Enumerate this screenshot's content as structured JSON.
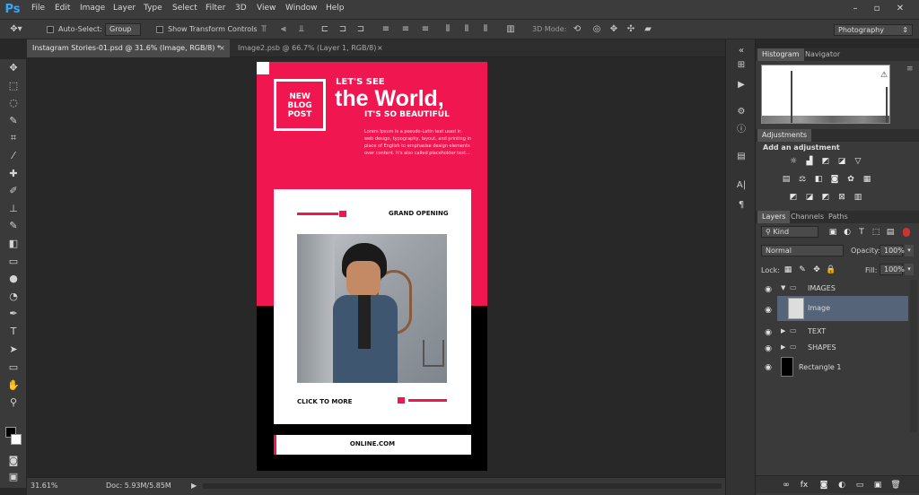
{
  "app": {
    "logo": "Ps"
  },
  "menu": [
    "File",
    "Edit",
    "Image",
    "Layer",
    "Type",
    "Select",
    "Filter",
    "3D",
    "View",
    "Window",
    "Help"
  ],
  "window_controls": {
    "minimize": "–",
    "maximize": "▫",
    "close": "✕"
  },
  "options": {
    "auto_select_label": "Auto-Select:",
    "auto_select_value": "Group",
    "show_transform_label": "Show Transform Controls",
    "mode_3d_label": "3D Mode:",
    "workspace": "Photography"
  },
  "tabs": [
    {
      "label": "Instagram Stories-01.psd @ 31.6% (Image, RGB/8) *",
      "close": "×"
    },
    {
      "label": "Image2.psb @ 66.7% (Layer 1, RGB/8)",
      "close": "×"
    }
  ],
  "status": {
    "zoom": "31.61%",
    "doc": "Doc: 5.93M/5.85M",
    "arrow": "▶"
  },
  "design": {
    "badge_line1": "NEW",
    "badge_line2": "BLOG",
    "badge_line3": "POST",
    "lets_see": "LET'S SEE",
    "headline": "the World,",
    "subhead": "IT'S SO BEAUTIFUL",
    "body": "Lorem Ipsum is a pseudo-Latin text used in web design, typography, layout, and printing in place of English to emphasise design elements over content. It's also called placeholder text...",
    "grand_opening": "GRAND OPENING",
    "click_to_more": "CLICK TO MORE",
    "online": "ONLINE.COM",
    "accent": "#f0164f"
  },
  "panels": {
    "top_tabs": [
      "Histogram",
      "Navigator"
    ],
    "adjustments_tab": "Adjustments",
    "add_adjustment": "Add an adjustment",
    "layer_tabs": [
      "Layers",
      "Channels",
      "Paths"
    ],
    "kind": "Kind",
    "blend_mode": "Normal",
    "opacity_label": "Opacity:",
    "opacity_value": "100%",
    "lock_label": "Lock:",
    "fill_label": "Fill:",
    "fill_value": "100%"
  },
  "layers": [
    {
      "name": "IMAGES",
      "type": "group",
      "expanded": true
    },
    {
      "name": "Image",
      "type": "layer",
      "selected": true
    },
    {
      "name": "TEXT",
      "type": "group",
      "expanded": false
    },
    {
      "name": "SHAPES",
      "type": "group",
      "expanded": false
    },
    {
      "name": "Rectangle 1",
      "type": "shape"
    }
  ],
  "footer_icons": [
    "link-icon",
    "fx-icon",
    "mask-icon",
    "adjustment-layer-icon",
    "folder-icon",
    "new-layer-icon",
    "trash-icon"
  ]
}
